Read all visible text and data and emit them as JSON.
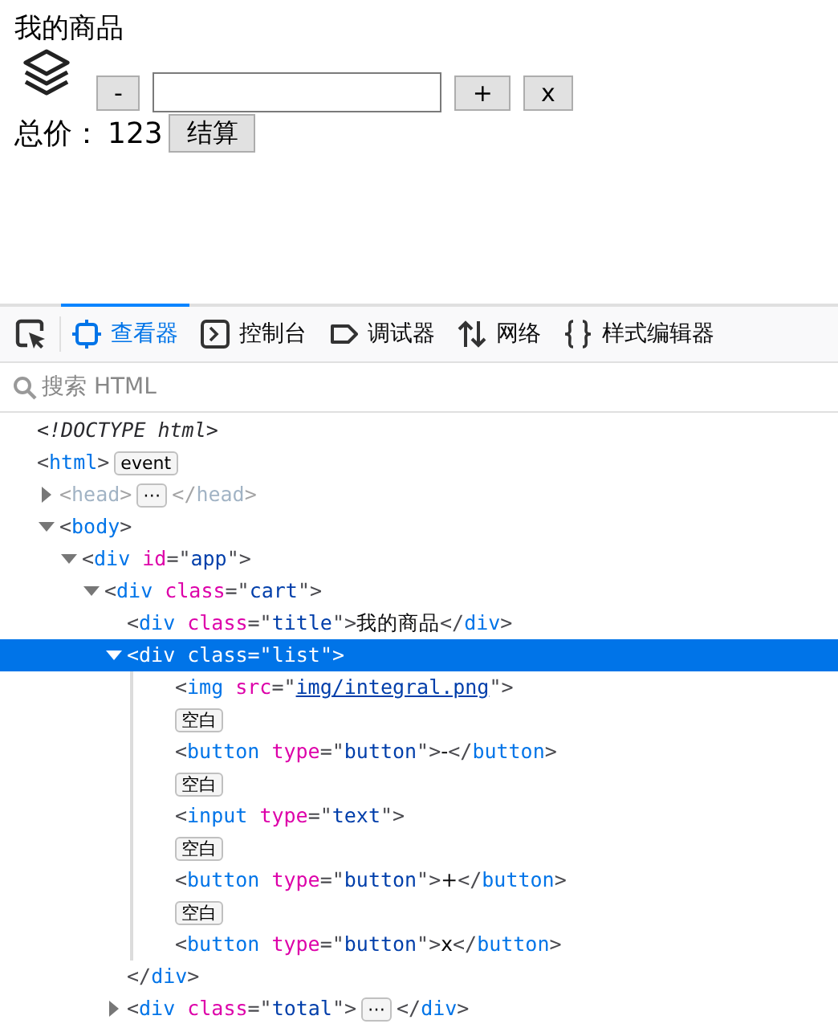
{
  "preview": {
    "title": "我的商品",
    "buttons": [
      "-",
      "+",
      "x"
    ],
    "total_label": "总价：",
    "total_value": "123",
    "checkout": "结算"
  },
  "toolbar": {
    "tabs": [
      {
        "label": "查看器",
        "selected": true
      },
      {
        "label": "控制台",
        "selected": false
      },
      {
        "label": "调试器",
        "selected": false
      },
      {
        "label": "网络",
        "selected": false
      },
      {
        "label": "样式编辑器",
        "selected": false
      }
    ]
  },
  "search": {
    "placeholder": "搜索 HTML"
  },
  "tree": [
    {
      "tokens": [
        {
          "kind": "doctype",
          "text": "<!DOCTYPE html>"
        }
      ]
    },
    {
      "tokens": [
        {
          "kind": "punct",
          "text": "<"
        },
        {
          "kind": "tag",
          "text": "html"
        },
        {
          "kind": "punct",
          "text": ">"
        }
      ],
      "badge": "event",
      "children": [
        {
          "tokens": [
            {
              "kind": "punct",
              "text": "<"
            },
            {
              "kind": "tag",
              "text": "head"
            },
            {
              "kind": "punct",
              "text": ">"
            }
          ],
          "after": [
            {
              "kind": "punct",
              "text": "</"
            },
            {
              "kind": "tag",
              "text": "head"
            },
            {
              "kind": "punct",
              "text": ">"
            }
          ],
          "badge": "⋯",
          "expanded": false,
          "dimmed": true
        },
        {
          "tokens": [
            {
              "kind": "punct",
              "text": "<"
            },
            {
              "kind": "tag",
              "text": "body"
            },
            {
              "kind": "punct",
              "text": ">"
            }
          ],
          "expanded": true,
          "children": [
            {
              "tokens": [
                {
                  "kind": "punct",
                  "text": "<"
                },
                {
                  "kind": "tag",
                  "text": "div"
                },
                {
                  "kind": "attr",
                  "text": " id"
                },
                {
                  "kind": "punct",
                  "text": "=\""
                },
                {
                  "kind": "value",
                  "text": "app"
                },
                {
                  "kind": "punct",
                  "text": "\">"
                }
              ],
              "expanded": true,
              "children": [
                {
                  "tokens": [
                    {
                      "kind": "punct",
                      "text": "<"
                    },
                    {
                      "kind": "tag",
                      "text": "div"
                    },
                    {
                      "kind": "attr",
                      "text": " class"
                    },
                    {
                      "kind": "punct",
                      "text": "=\""
                    },
                    {
                      "kind": "value",
                      "text": "cart"
                    },
                    {
                      "kind": "punct",
                      "text": "\">"
                    }
                  ],
                  "expanded": true,
                  "children": [
                    {
                      "tokens": [
                        {
                          "kind": "punct",
                          "text": "<"
                        },
                        {
                          "kind": "tag",
                          "text": "div"
                        },
                        {
                          "kind": "attr",
                          "text": " class"
                        },
                        {
                          "kind": "punct",
                          "text": "=\""
                        },
                        {
                          "kind": "value",
                          "text": "title"
                        },
                        {
                          "kind": "punct",
                          "text": "\">"
                        },
                        {
                          "kind": "text",
                          "text": "我的商品"
                        },
                        {
                          "kind": "punct",
                          "text": "</"
                        },
                        {
                          "kind": "tag",
                          "text": "div"
                        },
                        {
                          "kind": "punct",
                          "text": ">"
                        }
                      ]
                    },
                    {
                      "tokens": [
                        {
                          "kind": "punct",
                          "text": "<"
                        },
                        {
                          "kind": "tag",
                          "text": "div"
                        },
                        {
                          "kind": "attr",
                          "text": " class"
                        },
                        {
                          "kind": "punct",
                          "text": "=\""
                        },
                        {
                          "kind": "value",
                          "text": "list"
                        },
                        {
                          "kind": "punct",
                          "text": "\">"
                        }
                      ],
                      "expanded": true,
                      "selected": true,
                      "closing": [
                        {
                          "kind": "punct",
                          "text": "</"
                        },
                        {
                          "kind": "tag",
                          "text": "div"
                        },
                        {
                          "kind": "punct",
                          "text": ">"
                        }
                      ],
                      "children": [
                        {
                          "tokens": [
                            {
                              "kind": "punct",
                              "text": "<"
                            },
                            {
                              "kind": "tag",
                              "text": "img"
                            },
                            {
                              "kind": "attr",
                              "text": " src"
                            },
                            {
                              "kind": "punct",
                              "text": "=\""
                            },
                            {
                              "kind": "link",
                              "text": "img/integral.png"
                            },
                            {
                              "kind": "punct",
                              "text": "\">"
                            }
                          ]
                        },
                        {
                          "badge": "空白"
                        },
                        {
                          "tokens": [
                            {
                              "kind": "punct",
                              "text": "<"
                            },
                            {
                              "kind": "tag",
                              "text": "button"
                            },
                            {
                              "kind": "attr",
                              "text": " type"
                            },
                            {
                              "kind": "punct",
                              "text": "=\""
                            },
                            {
                              "kind": "value",
                              "text": "button"
                            },
                            {
                              "kind": "punct",
                              "text": "\">"
                            },
                            {
                              "kind": "text",
                              "text": "-"
                            },
                            {
                              "kind": "punct",
                              "text": "</"
                            },
                            {
                              "kind": "tag",
                              "text": "button"
                            },
                            {
                              "kind": "punct",
                              "text": ">"
                            }
                          ]
                        },
                        {
                          "badge": "空白"
                        },
                        {
                          "tokens": [
                            {
                              "kind": "punct",
                              "text": "<"
                            },
                            {
                              "kind": "tag",
                              "text": "input"
                            },
                            {
                              "kind": "attr",
                              "text": " type"
                            },
                            {
                              "kind": "punct",
                              "text": "=\""
                            },
                            {
                              "kind": "value",
                              "text": "text"
                            },
                            {
                              "kind": "punct",
                              "text": "\">"
                            }
                          ]
                        },
                        {
                          "badge": "空白"
                        },
                        {
                          "tokens": [
                            {
                              "kind": "punct",
                              "text": "<"
                            },
                            {
                              "kind": "tag",
                              "text": "button"
                            },
                            {
                              "kind": "attr",
                              "text": " type"
                            },
                            {
                              "kind": "punct",
                              "text": "=\""
                            },
                            {
                              "kind": "value",
                              "text": "button"
                            },
                            {
                              "kind": "punct",
                              "text": "\">"
                            },
                            {
                              "kind": "text",
                              "text": "+"
                            },
                            {
                              "kind": "punct",
                              "text": "</"
                            },
                            {
                              "kind": "tag",
                              "text": "button"
                            },
                            {
                              "kind": "punct",
                              "text": ">"
                            }
                          ]
                        },
                        {
                          "badge": "空白"
                        },
                        {
                          "tokens": [
                            {
                              "kind": "punct",
                              "text": "<"
                            },
                            {
                              "kind": "tag",
                              "text": "button"
                            },
                            {
                              "kind": "attr",
                              "text": " type"
                            },
                            {
                              "kind": "punct",
                              "text": "=\""
                            },
                            {
                              "kind": "value",
                              "text": "button"
                            },
                            {
                              "kind": "punct",
                              "text": "\">"
                            },
                            {
                              "kind": "text",
                              "text": "x"
                            },
                            {
                              "kind": "punct",
                              "text": "</"
                            },
                            {
                              "kind": "tag",
                              "text": "button"
                            },
                            {
                              "kind": "punct",
                              "text": ">"
                            }
                          ]
                        }
                      ]
                    },
                    {
                      "tokens": [
                        {
                          "kind": "punct",
                          "text": "<"
                        },
                        {
                          "kind": "tag",
                          "text": "div"
                        },
                        {
                          "kind": "attr",
                          "text": " class"
                        },
                        {
                          "kind": "punct",
                          "text": "=\""
                        },
                        {
                          "kind": "value",
                          "text": "total"
                        },
                        {
                          "kind": "punct",
                          "text": "\">"
                        }
                      ],
                      "after": [
                        {
                          "kind": "punct",
                          "text": "</"
                        },
                        {
                          "kind": "tag",
                          "text": "div"
                        },
                        {
                          "kind": "punct",
                          "text": ">"
                        }
                      ],
                      "badge": "⋯",
                      "expanded": false
                    }
                  ]
                }
              ]
            }
          ]
        }
      ]
    }
  ]
}
